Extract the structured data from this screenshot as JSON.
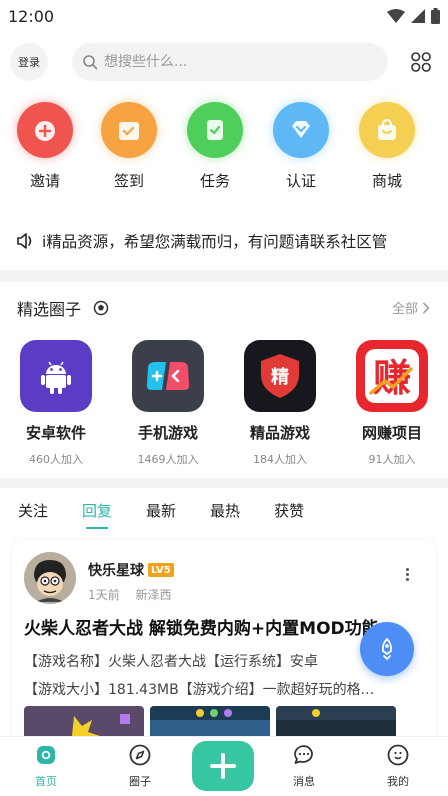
{
  "status_bar": {
    "time": "12:00"
  },
  "header": {
    "login_label": "登录",
    "search_placeholder": "想搜些什么..."
  },
  "quick_actions": [
    {
      "label": "邀请",
      "icon": "invite-icon",
      "color": "#f0544f"
    },
    {
      "label": "签到",
      "icon": "checkin-icon",
      "color": "#f7a243"
    },
    {
      "label": "任务",
      "icon": "task-icon",
      "color": "#4ecf5c"
    },
    {
      "label": "认证",
      "icon": "verify-icon",
      "color": "#5db8f5"
    },
    {
      "label": "商城",
      "icon": "shop-icon",
      "color": "#f5cf52"
    }
  ],
  "notice": {
    "text": "i精品资源，希望您满载而归，有问题请联系社区管"
  },
  "circles": {
    "title": "精选圈子",
    "more_label": "全部",
    "items": [
      {
        "name": "安卓软件",
        "count": "460人加入",
        "icon": "android-icon"
      },
      {
        "name": "手机游戏",
        "count": "1469人加入",
        "icon": "gamepad-icon"
      },
      {
        "name": "精品游戏",
        "count": "184人加入",
        "icon": "shield-jing-icon",
        "badge_text": "精"
      },
      {
        "name": "网赚项目",
        "count": "91人加入",
        "icon": "earn-icon",
        "badge_text": "赚"
      }
    ]
  },
  "feed": {
    "tabs": [
      {
        "label": "关注",
        "active": false
      },
      {
        "label": "回复",
        "active": true
      },
      {
        "label": "最新",
        "active": false
      },
      {
        "label": "最热",
        "active": false
      },
      {
        "label": "获赞",
        "active": false
      }
    ],
    "post": {
      "author": "快乐星球",
      "level": "LV5",
      "time": "1天前",
      "location": "新泽西",
      "title": "火柴人忍者大战 解锁免费内购+内置MOD功能",
      "body_line1": "【游戏名称】火柴人忍者大战【运行系统】安卓",
      "body_line2": "【游戏大小】181.43MB【游戏介绍】一款超好玩的格..."
    }
  },
  "bottom_nav": {
    "items": [
      {
        "label": "首页",
        "active": true
      },
      {
        "label": "圈子",
        "active": false
      },
      {
        "label": "消息",
        "active": false
      },
      {
        "label": "我的",
        "active": false
      }
    ]
  },
  "colors": {
    "accent": "#2bb6a8",
    "fab": "#37c6a2",
    "rocket": "#4e8df5"
  }
}
